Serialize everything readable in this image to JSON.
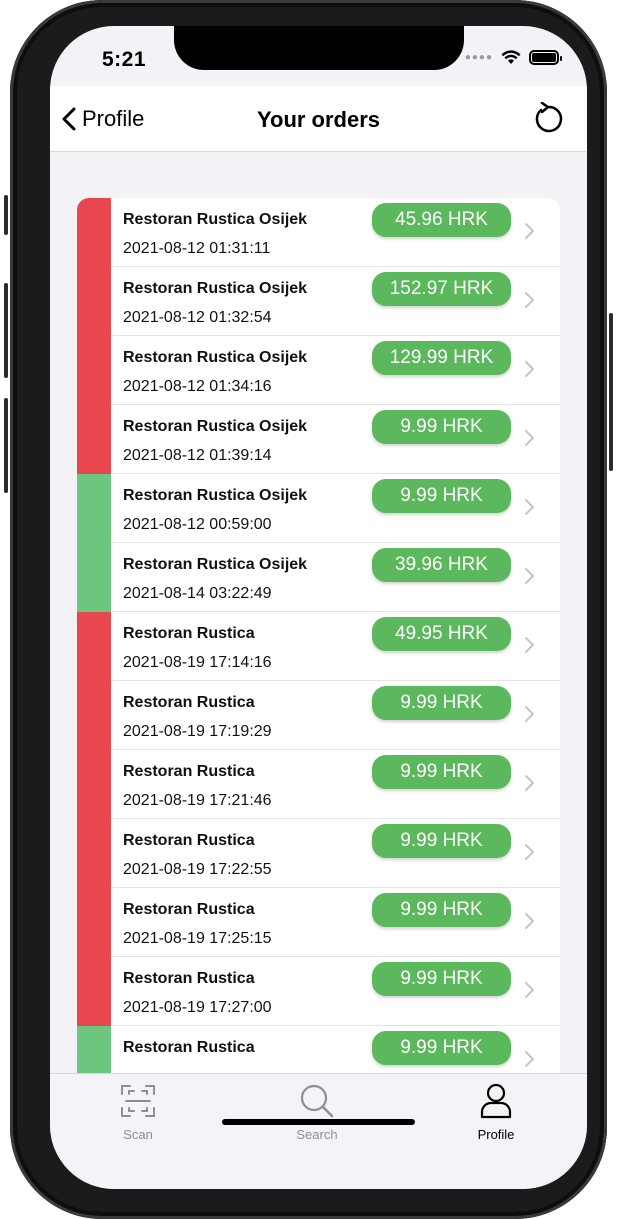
{
  "status": {
    "time": "5:21"
  },
  "nav": {
    "back_label": "Profile",
    "title": "Your orders",
    "refresh_icon": "refresh-icon"
  },
  "colors": {
    "unpaid": "#e8474f",
    "paid": "#6cc67f",
    "price_bg": "#5cb85c"
  },
  "orders": [
    {
      "name": "Restoran Rustica Osijek",
      "date": "2021-08-12 01:31:11",
      "price": "45.96 HRK",
      "status": "unpaid"
    },
    {
      "name": "Restoran Rustica Osijek",
      "date": "2021-08-12 01:32:54",
      "price": "152.97 HRK",
      "status": "unpaid"
    },
    {
      "name": "Restoran Rustica Osijek",
      "date": "2021-08-12 01:34:16",
      "price": "129.99 HRK",
      "status": "unpaid"
    },
    {
      "name": "Restoran Rustica Osijek",
      "date": "2021-08-12 01:39:14",
      "price": "9.99 HRK",
      "status": "unpaid"
    },
    {
      "name": "Restoran Rustica Osijek",
      "date": "2021-08-12 00:59:00",
      "price": "9.99 HRK",
      "status": "paid"
    },
    {
      "name": "Restoran Rustica Osijek",
      "date": "2021-08-14 03:22:49",
      "price": "39.96 HRK",
      "status": "paid"
    },
    {
      "name": "Restoran Rustica",
      "date": "2021-08-19 17:14:16",
      "price": "49.95 HRK",
      "status": "unpaid"
    },
    {
      "name": "Restoran Rustica",
      "date": "2021-08-19 17:19:29",
      "price": "9.99 HRK",
      "status": "unpaid"
    },
    {
      "name": "Restoran Rustica",
      "date": "2021-08-19 17:21:46",
      "price": "9.99 HRK",
      "status": "unpaid"
    },
    {
      "name": "Restoran Rustica",
      "date": "2021-08-19 17:22:55",
      "price": "9.99 HRK",
      "status": "unpaid"
    },
    {
      "name": "Restoran Rustica",
      "date": "2021-08-19 17:25:15",
      "price": "9.99 HRK",
      "status": "unpaid"
    },
    {
      "name": "Restoran Rustica",
      "date": "2021-08-19 17:27:00",
      "price": "9.99 HRK",
      "status": "unpaid"
    },
    {
      "name": "Restoran Rustica",
      "date": "",
      "price": "9.99 HRK",
      "status": "paid"
    }
  ],
  "tabs": [
    {
      "label": "Scan",
      "icon": "scan-icon",
      "active": false
    },
    {
      "label": "Search",
      "icon": "search-icon",
      "active": false
    },
    {
      "label": "Profile",
      "icon": "profile-icon",
      "active": true
    }
  ]
}
